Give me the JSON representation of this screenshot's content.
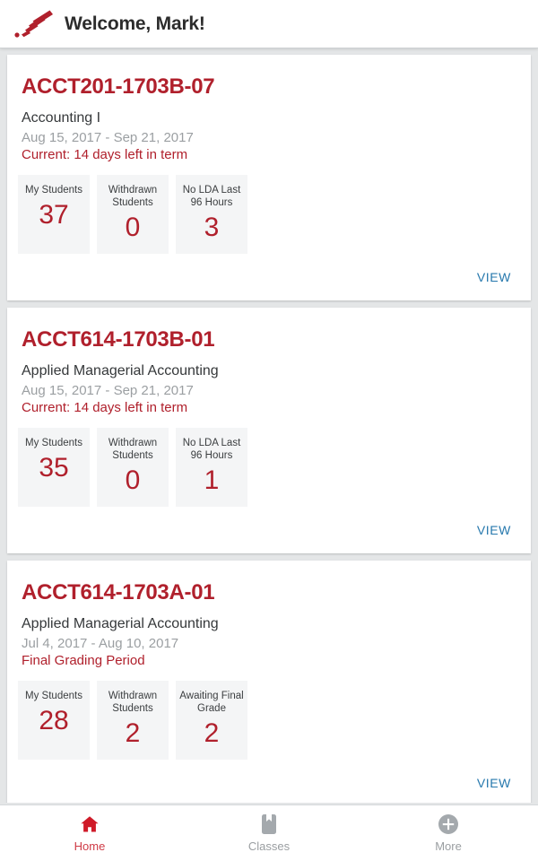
{
  "header": {
    "logo_icon": "fan-logo-icon",
    "title": "Welcome, Mark!",
    "brand_color": "#b0202c"
  },
  "cards": [
    {
      "code": "ACCT201-1703B-07",
      "name": "Accounting I",
      "dates": "Aug 15, 2017 - Sep 21, 2017",
      "status": "Current: 14 days left in term",
      "stats": [
        {
          "label": "My Students",
          "value": "37"
        },
        {
          "label": "Withdrawn Students",
          "value": "0"
        },
        {
          "label": "No LDA Last 96 Hours",
          "value": "3"
        }
      ],
      "view_label": "VIEW"
    },
    {
      "code": "ACCT614-1703B-01",
      "name": "Applied Managerial Accounting",
      "dates": "Aug 15, 2017 - Sep 21, 2017",
      "status": "Current: 14 days left in term",
      "stats": [
        {
          "label": "My Students",
          "value": "35"
        },
        {
          "label": "Withdrawn Students",
          "value": "0"
        },
        {
          "label": "No LDA Last 96 Hours",
          "value": "1"
        }
      ],
      "view_label": "VIEW"
    },
    {
      "code": "ACCT614-1703A-01",
      "name": "Applied Managerial Accounting",
      "dates": "Jul 4, 2017 - Aug 10, 2017",
      "status": "Final Grading Period",
      "stats": [
        {
          "label": "My Students",
          "value": "28"
        },
        {
          "label": "Withdrawn Students",
          "value": "2"
        },
        {
          "label": "Awaiting Final Grade",
          "value": "2"
        }
      ],
      "view_label": "VIEW"
    }
  ],
  "bottom_nav": {
    "items": [
      {
        "label": "Home",
        "icon": "home-icon",
        "active": true
      },
      {
        "label": "Classes",
        "icon": "book-icon",
        "active": false
      },
      {
        "label": "More",
        "icon": "plus-circle-icon",
        "active": false
      }
    ],
    "active_color": "#cf3b46",
    "inactive_color": "#9a9ea1"
  }
}
